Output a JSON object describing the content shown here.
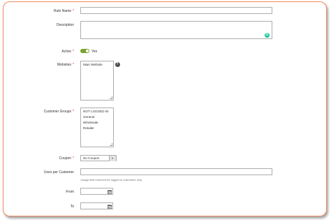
{
  "form": {
    "rule_name_label": "Rule Name",
    "description_label": "Description",
    "active_label": "Active",
    "active_value": "Yes",
    "websites_label": "Websites",
    "websites_options": [
      "Main Website"
    ],
    "customer_groups_label": "Customer Groups",
    "customer_groups_options": [
      "NOT LOGGED IN",
      "General",
      "Wholesale",
      "Retailer"
    ],
    "coupon_label": "Coupon",
    "coupon_value": "No Coupon",
    "uses_per_customer_label": "Uses per Customer",
    "uses_note": "Usage limit enforced for logged in customers only.",
    "from_label": "From",
    "to_label": "To",
    "required_mark": "*",
    "help_mark": "?"
  },
  "colors": {
    "frame_border": "#f08a5d",
    "toggle_on": "#79a22e",
    "required": "#e22626",
    "grammarly": "#15c39a"
  },
  "icons": [
    "question-help-icon",
    "grammarly-icon",
    "dropdown-arrow-icon",
    "calendar-icon"
  ]
}
